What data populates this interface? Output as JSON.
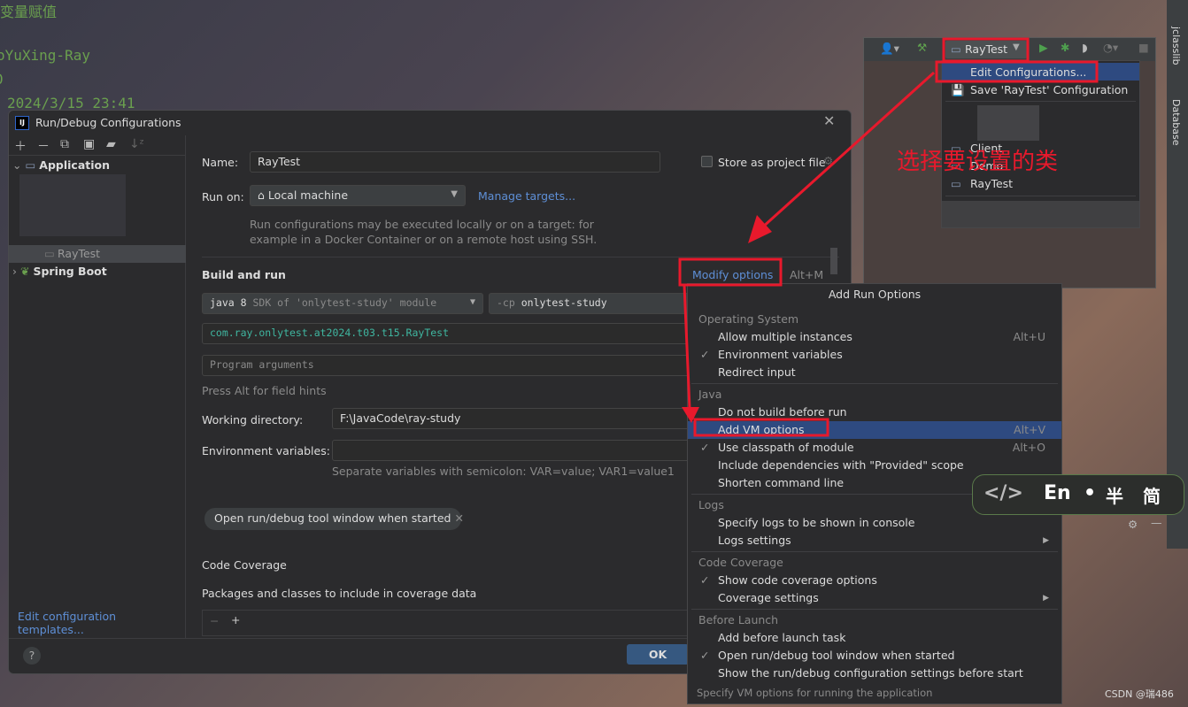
{
  "background_code": {
    "lines": [
      "变量赋值",
      "oYuXing-Ray",
      "0",
      "2024/3/15 23:41"
    ]
  },
  "dialog": {
    "title": "Run/Debug Configurations",
    "tree": {
      "application": "Application",
      "raytest": "RayTest",
      "spring_boot": "Spring Boot"
    },
    "edit_templates": "Edit configuration templates...",
    "name_label": "Name:",
    "name_value": "RayTest",
    "store_label": "Store as project file",
    "run_on_label": "Run on:",
    "run_on_value": "Local machine",
    "manage_targets": "Manage targets...",
    "run_on_hint": [
      "Run configurations may be executed locally or on a target: for",
      "example in a Docker Container or on a remote host using SSH."
    ],
    "build_and_run": "Build and run",
    "modify_options": "Modify options",
    "modify_shortcut": "Alt+M",
    "jdk_value": "java 8",
    "jdk_hint": "SDK of 'onlytest-study' module",
    "cp_prefix": "-cp",
    "cp_value": "onlytest-study",
    "main_class": "com.ray.onlytest.at2024.t03.t15.RayTest",
    "program_args_placeholder": "Program arguments",
    "field_hints": "Press Alt for field hints",
    "working_dir_label": "Working directory:",
    "working_dir_value": "F:\\JavaCode\\ray-study",
    "env_label": "Environment variables:",
    "env_value": "",
    "env_hint": "Separate variables with semicolon: VAR=value; VAR1=value1",
    "chip": "Open run/debug tool window when started",
    "code_coverage": "Code Coverage",
    "packages_label": "Packages and classes to include in coverage data",
    "ok": "OK"
  },
  "menu": {
    "title": "Add Run Options",
    "sections": [
      {
        "header": "Operating System",
        "items": [
          {
            "label": "Allow multiple instances",
            "shortcut": "Alt+U"
          },
          {
            "label": "Environment variables",
            "checked": true
          },
          {
            "label": "Redirect input"
          }
        ]
      },
      {
        "header": "Java",
        "items": [
          {
            "label": "Do not build before run"
          },
          {
            "label": "Add VM options",
            "shortcut": "Alt+V",
            "selected": true
          },
          {
            "label": "Use classpath of module",
            "shortcut": "Alt+O",
            "checked": true
          },
          {
            "label": "Include dependencies with \"Provided\" scope"
          },
          {
            "label": "Shorten command line"
          }
        ]
      },
      {
        "header": "Logs",
        "items": [
          {
            "label": "Specify logs to be shown in console"
          },
          {
            "label": "Logs settings",
            "submenu": true
          }
        ]
      },
      {
        "header": "Code Coverage",
        "items": [
          {
            "label": "Show code coverage options",
            "checked": true
          },
          {
            "label": "Coverage settings",
            "submenu": true
          }
        ]
      },
      {
        "header": "Before Launch",
        "items": [
          {
            "label": "Add before launch task"
          },
          {
            "label": "Open run/debug tool window when started",
            "checked": true
          },
          {
            "label": "Show the run/debug configuration settings before start"
          }
        ]
      }
    ],
    "footer": "Specify VM options for running the application"
  },
  "ide": {
    "run_config": "RayTest",
    "dropdown": {
      "edit": "Edit Configurations...",
      "save": "Save 'RayTest' Configuration",
      "items": [
        "Client",
        "Demo",
        "RayTest"
      ]
    },
    "side_tabs": [
      "jclasslib",
      "Database"
    ]
  },
  "annotation": "选择要设置的类",
  "ime": {
    "code": "</>",
    "lang": "En",
    "dot": "•",
    "half": "半",
    "simp": "简"
  },
  "watermark": "CSDN @瑞486",
  "colors": {
    "accent": "#2f65ca",
    "selection": "#2e4a80",
    "annotation": "#e8192c"
  }
}
